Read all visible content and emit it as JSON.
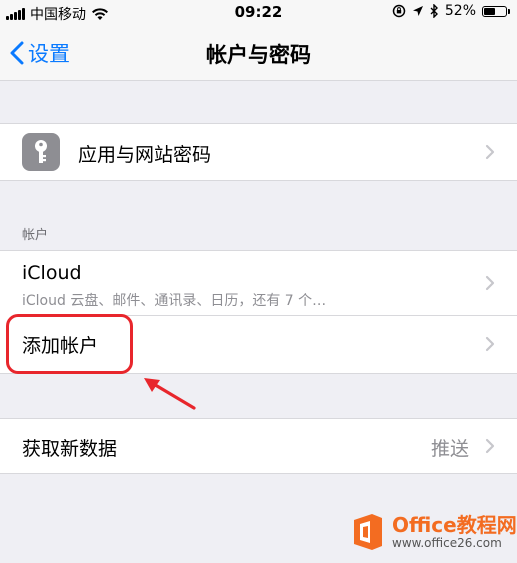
{
  "status_bar": {
    "carrier": "中国移动",
    "time": "09:22",
    "battery": "52%",
    "battery_level": 0.52
  },
  "nav": {
    "back_label": "设置",
    "title": "帐户与密码"
  },
  "passwords_row": {
    "label": "应用与网站密码",
    "icon": "key-icon"
  },
  "accounts_section": {
    "header": "帐户",
    "icloud": {
      "title": "iCloud",
      "subtitle": "iCloud 云盘、邮件、通讯录、日历，还有 7 个…"
    },
    "add_account": "添加帐户"
  },
  "fetch_row": {
    "label": "获取新数据",
    "value": "推送"
  },
  "watermark": {
    "title": "Office教程网",
    "url": "www.office26.com"
  },
  "colors": {
    "accent": "#0a7aff",
    "annotation": "#e8262c",
    "background": "#efeff4"
  }
}
